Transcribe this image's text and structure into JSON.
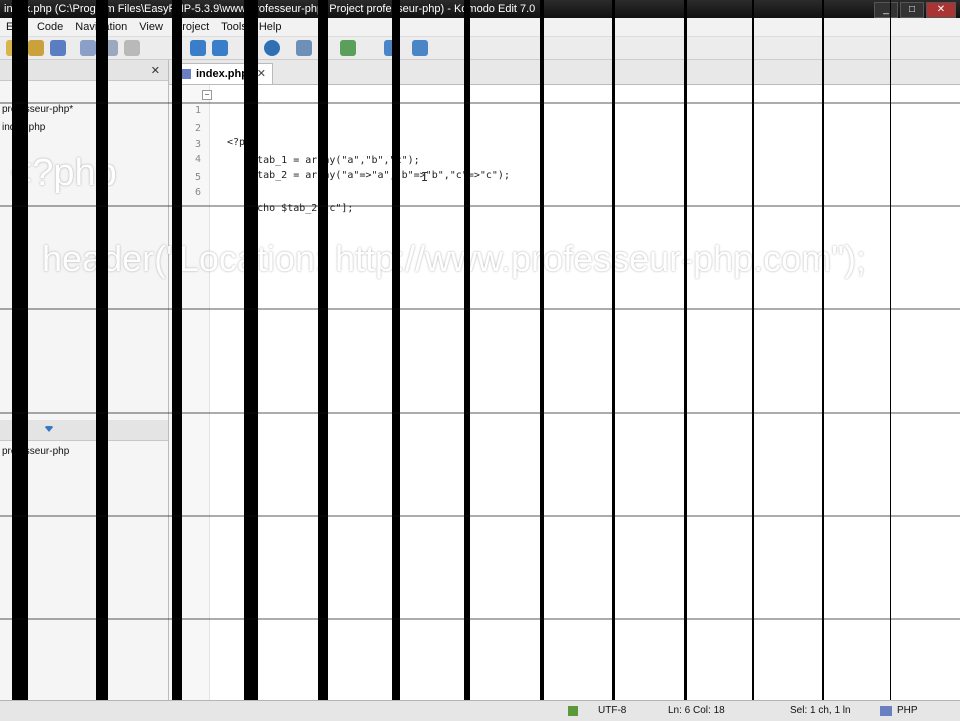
{
  "window": {
    "title": "index.php (C:\\Program Files\\EasyPHP-5.3.9\\www\\professeur-php, Project professeur-php) - Komodo Edit 7.0",
    "buttons": [
      "_",
      "□",
      "✕"
    ]
  },
  "menu": [
    "Edit",
    "Code",
    "Navigation",
    "View",
    "Project",
    "Tools",
    "Help"
  ],
  "left_pane": {
    "project_name": "professeur-php*",
    "file": "index.php",
    "lower_project": "professeur-php",
    "close_label": "✕"
  },
  "editor": {
    "tab_label": "index.php",
    "tab_close": "✕",
    "lines": [
      {
        "num": "1",
        "code": "<?php"
      },
      {
        "num": "2",
        "code": ""
      },
      {
        "num": "3",
        "code": "    $tab_1 = array(\"a\",\"b\",\"c\");"
      },
      {
        "num": "4",
        "code": "    $tab_2 = array(\"a\"=>\"a\",\"b\"=>\"b\",\"c\"=>\"c\");"
      },
      {
        "num": "5",
        "code": ""
      },
      {
        "num": "6",
        "code": "    echo $tab_2[\"c\"];"
      }
    ]
  },
  "overlay": {
    "line1": "<?php",
    "line2": "header(\"Location: http://www.professeur-php.com\");"
  },
  "status": {
    "encoding": "UTF-8",
    "position": "Ln: 6 Col: 18",
    "selection": "Sel: 1 ch, 1 ln",
    "language": "PHP"
  }
}
